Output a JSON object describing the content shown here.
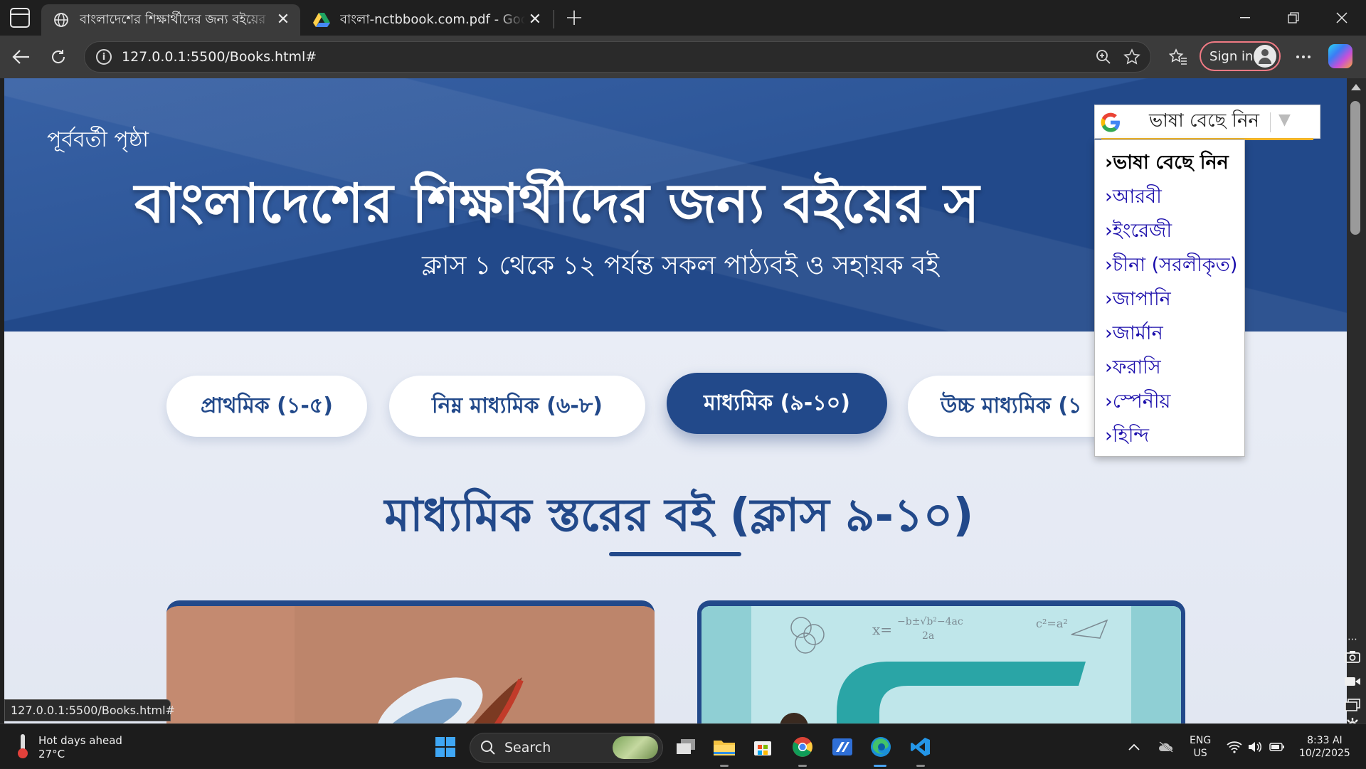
{
  "browser": {
    "tabs": [
      {
        "title": "বাংলাদেশের শিক্ষার্থীদের জন্য বইয়ের",
        "favicon": "globe-icon",
        "active": true
      },
      {
        "title": "বাংলা-nctbbook.com.pdf - Google",
        "favicon": "google-drive-icon",
        "active": false
      }
    ],
    "close_glyph": "✕",
    "new_tab_glyph": "+",
    "url": "127.0.0.1:5500/Books.html#",
    "signin_label": "Sign in",
    "status_url": "127.0.0.1:5500/Books.html#"
  },
  "page": {
    "back_link": "পূর্ববর্তী পৃষ্ঠা",
    "hero_title": "বাংলাদেশের শিক্ষার্থীদের জন্য বইয়ের স",
    "hero_subtitle": "ক্লাস ১ থেকে ১২ পর্যন্ত সকল পাঠ্যবই ও সহায়ক বই",
    "levels": [
      {
        "label": "প্রাথমিক (১-৫)",
        "active": false
      },
      {
        "label": "নিম্ন মাধ্যমিক (৬-৮)",
        "active": false
      },
      {
        "label": "মাধ্যমিক (৯-১০)",
        "active": true
      },
      {
        "label": "উচ্চ মাধ্যমিক (১",
        "active": false
      }
    ],
    "section_title": "মাধ্যমিক স্তরের বই (ক্লাস ৯-১০)"
  },
  "translate": {
    "select_label": "ভাষা বেছে নিন",
    "options": [
      {
        "label": "›ভাষা বেছে নিন",
        "selected": true
      },
      {
        "label": "›আরবী",
        "selected": false
      },
      {
        "label": "›ইংরেজী",
        "selected": false
      },
      {
        "label": "›চীনা (সরলীকৃত)",
        "selected": false
      },
      {
        "label": "›জাপানি",
        "selected": false
      },
      {
        "label": "›জার্মান",
        "selected": false
      },
      {
        "label": "›ফরাসি",
        "selected": false
      },
      {
        "label": "›স্পেনীয়",
        "selected": false
      },
      {
        "label": "›হিন্দি",
        "selected": false
      }
    ]
  },
  "taskbar": {
    "weather_title": "Hot days ahead",
    "weather_temp": "27°C",
    "search_label": "Search",
    "lang_line1": "ENG",
    "lang_line2": "US",
    "time": "8:33 AI",
    "date": "10/2/2025"
  },
  "colors": {
    "brand_blue": "#22498a",
    "link_blue": "#1a0dab",
    "signin_border": "#f07a84"
  }
}
